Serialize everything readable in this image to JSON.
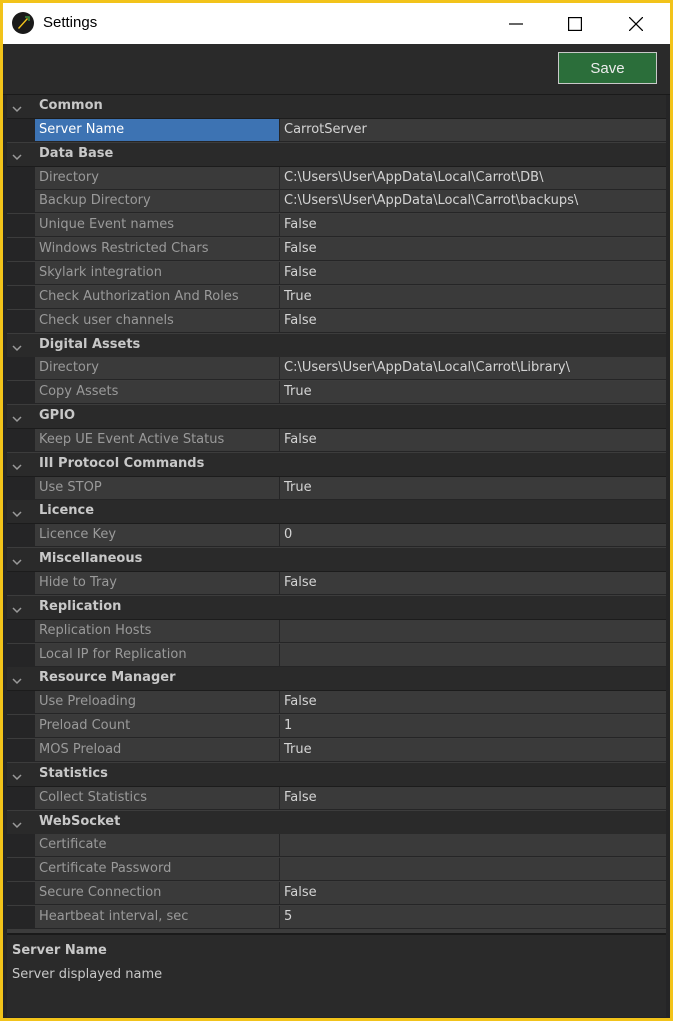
{
  "window": {
    "title": "Settings",
    "accent_border": "#f2c31a",
    "controls": [
      "minimize-icon",
      "maximize-icon",
      "close-icon"
    ]
  },
  "toolbar": {
    "save_label": "Save",
    "save_color": "#2b6e3a"
  },
  "categories": [
    {
      "label": "Common",
      "rows": [
        {
          "name": "Server Name",
          "value": "CarrotServer",
          "selected": true
        }
      ]
    },
    {
      "label": "Data Base",
      "rows": [
        {
          "name": "Directory",
          "value": "C:\\Users\\User\\AppData\\Local\\Carrot\\DB\\"
        },
        {
          "name": "Backup Directory",
          "value": "C:\\Users\\User\\AppData\\Local\\Carrot\\backups\\"
        },
        {
          "name": "Unique Event names",
          "value": "False"
        },
        {
          "name": "Windows Restricted Chars",
          "value": "False"
        },
        {
          "name": "Skylark integration",
          "value": "False"
        },
        {
          "name": "Check Authorization And Roles",
          "value": "True"
        },
        {
          "name": "Check user channels",
          "value": "False"
        }
      ]
    },
    {
      "label": "Digital Assets",
      "rows": [
        {
          "name": "Directory",
          "value": "C:\\Users\\User\\AppData\\Local\\Carrot\\Library\\"
        },
        {
          "name": "Copy Assets",
          "value": "True"
        }
      ]
    },
    {
      "label": "GPIO",
      "rows": [
        {
          "name": "Keep UE Event Active Status",
          "value": "False"
        }
      ]
    },
    {
      "label": "III Protocol Commands",
      "rows": [
        {
          "name": "Use STOP",
          "value": "True"
        }
      ]
    },
    {
      "label": "Licence",
      "rows": [
        {
          "name": "Licence Key",
          "value": "0"
        }
      ]
    },
    {
      "label": "Miscellaneous",
      "rows": [
        {
          "name": "Hide to Tray",
          "value": "False"
        }
      ]
    },
    {
      "label": "Replication",
      "rows": [
        {
          "name": "Replication Hosts",
          "value": ""
        },
        {
          "name": "Local IP for Replication",
          "value": ""
        }
      ]
    },
    {
      "label": "Resource Manager",
      "rows": [
        {
          "name": "Use Preloading",
          "value": "False"
        },
        {
          "name": "Preload Count",
          "value": "1"
        },
        {
          "name": "MOS Preload",
          "value": "True"
        }
      ]
    },
    {
      "label": "Statistics",
      "rows": [
        {
          "name": "Collect Statistics",
          "value": "False"
        }
      ]
    },
    {
      "label": "WebSocket",
      "rows": [
        {
          "name": "Certificate",
          "value": ""
        },
        {
          "name": "Certificate Password",
          "value": ""
        },
        {
          "name": "Secure Connection",
          "value": "False"
        },
        {
          "name": "Heartbeat interval, sec",
          "value": "5"
        }
      ]
    }
  ],
  "description": {
    "title": "Server Name",
    "text": "Server displayed name"
  }
}
